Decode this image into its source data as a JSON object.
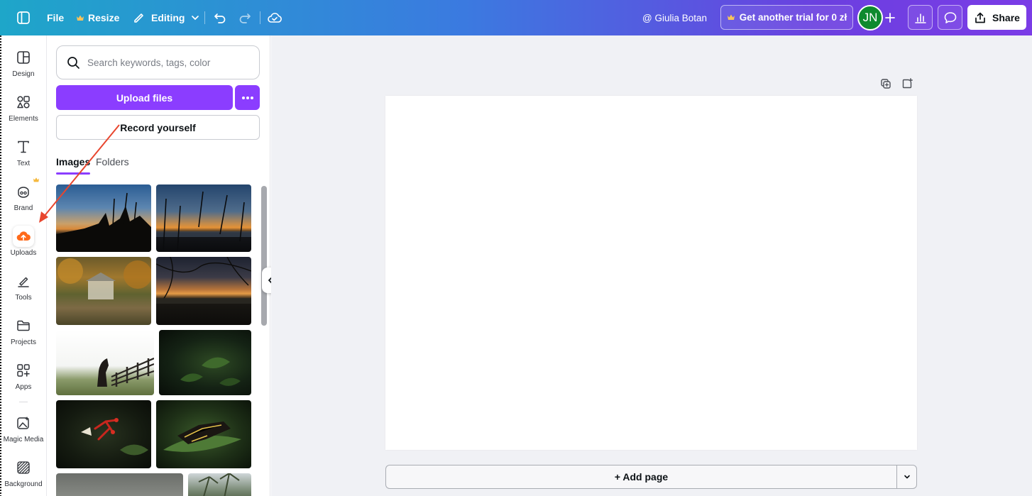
{
  "topbar": {
    "file": "File",
    "resize": "Resize",
    "editing": "Editing",
    "owner": "@ Giulia Botan",
    "trial": "Get another trial for 0 zł",
    "avatar_initials": "JN",
    "share": "Share",
    "icons": [
      "sidebar-toggle-icon",
      "crown-icon",
      "pencil-icon",
      "chevron-down-icon",
      "undo-icon",
      "redo-icon",
      "cloud-check-icon",
      "plus-icon",
      "analytics-icon",
      "comment-icon",
      "share-icon"
    ]
  },
  "rail": {
    "items": [
      {
        "label": "Design",
        "icon": "design-icon"
      },
      {
        "label": "Elements",
        "icon": "elements-icon"
      },
      {
        "label": "Text",
        "icon": "text-icon"
      },
      {
        "label": "Brand",
        "icon": "brand-icon"
      },
      {
        "label": "Uploads",
        "icon": "upload-cloud-icon"
      },
      {
        "label": "Tools",
        "icon": "tools-icon"
      },
      {
        "label": "Projects",
        "icon": "folder-icon"
      },
      {
        "label": "Apps",
        "icon": "apps-icon"
      },
      {
        "label": "Magic Media",
        "icon": "magic-media-icon"
      },
      {
        "label": "Background",
        "icon": "background-icon"
      }
    ],
    "active": "Uploads"
  },
  "panel": {
    "search_placeholder": "Search keywords, tags, color",
    "upload_files": "Upload files",
    "record_yourself": "Record yourself",
    "tabs": [
      {
        "label": "Images",
        "active": true
      },
      {
        "label": "Folders",
        "active": false
      }
    ]
  },
  "canvas": {
    "add_page": "+ Add page"
  },
  "colors": {
    "accent": "#8b3dff",
    "uploads_orange": "#ff6a1a",
    "avatar_green": "#0e8a2e",
    "annotation_arrow": "#e8462e"
  }
}
